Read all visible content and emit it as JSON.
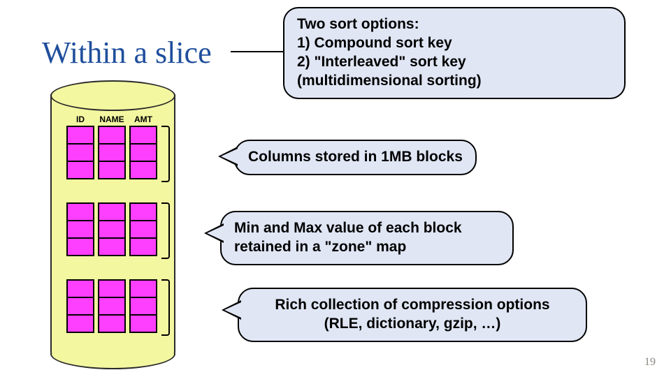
{
  "title": "Within a slice",
  "columns": [
    "ID",
    "NAME",
    "AMT"
  ],
  "callouts": {
    "top": "Two sort options:\n1)  Compound sort key\n2)  \"Interleaved\" sort key\n      (multidimensional sorting)",
    "blocks": "Columns stored in 1MB blocks",
    "zonemap": "Min and Max value of each block retained in a \"zone\" map",
    "compression": "Rich collection of compression options\n(RLE, dictionary, gzip, …)"
  },
  "page_number": "19"
}
